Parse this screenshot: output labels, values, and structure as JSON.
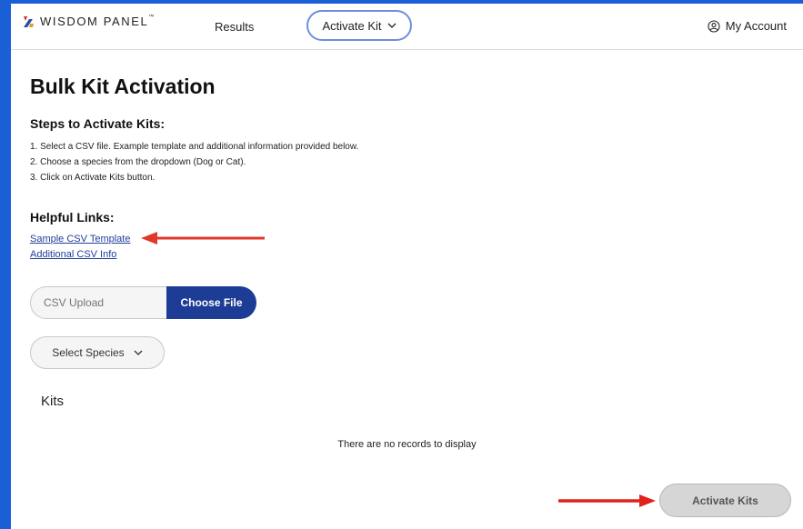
{
  "brand": {
    "name": "WISDOM PANEL",
    "trademark": "™"
  },
  "nav": {
    "results_label": "Results",
    "activate_label": "Activate Kit",
    "account_label": "My Account"
  },
  "page": {
    "title": "Bulk Kit Activation",
    "steps_title": "Steps to Activate Kits:",
    "steps": [
      "1. Select a CSV file. Example template and additional information provided below.",
      "2. Choose a species from the dropdown (Dog or Cat).",
      "3. Click on Activate Kits button."
    ],
    "links_title": "Helpful Links:",
    "links": [
      "Sample CSV Template",
      "Additional CSV Info"
    ]
  },
  "upload": {
    "placeholder": "CSV Upload",
    "choose_label": "Choose File"
  },
  "species_select": {
    "selected": "Select Species"
  },
  "kits": {
    "heading": "Kits",
    "empty_message": "There are no records to display"
  },
  "actions": {
    "activate_label": "Activate Kits"
  },
  "colors": {
    "frame_background": "#1a5fd6",
    "primary_button": "#1d3c95",
    "link": "#1f3d99",
    "annotation_arrow": "#e0392b",
    "disabled_button": "#d6d6d6"
  },
  "icons": {
    "logo": "wisdom-panel-logo-mark",
    "activate_dropdown": "chevron-down-icon",
    "account": "user-circle-icon",
    "species_dropdown": "chevron-down-icon",
    "annotation": "arrow-annotation"
  }
}
